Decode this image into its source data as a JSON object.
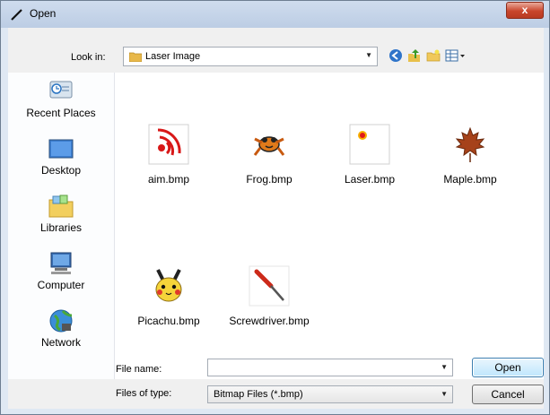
{
  "window": {
    "title": "Open",
    "close_glyph": "x"
  },
  "lookin": {
    "label": "Look in:",
    "value": "Laser Image",
    "arrow": "▼"
  },
  "toolbar": {
    "icons": [
      "back-icon",
      "up-folder-icon",
      "new-folder-icon",
      "view-menu-icon"
    ]
  },
  "places": [
    {
      "label": "Recent Places",
      "icon": "recent-places-icon"
    },
    {
      "label": "Desktop",
      "icon": "desktop-icon"
    },
    {
      "label": "Libraries",
      "icon": "libraries-icon"
    },
    {
      "label": "Computer",
      "icon": "computer-icon"
    },
    {
      "label": "Network",
      "icon": "network-icon"
    }
  ],
  "files": [
    {
      "name": "aim.bmp",
      "icon": "aim-icon"
    },
    {
      "name": "Frog.bmp",
      "icon": "frog-icon"
    },
    {
      "name": "Laser.bmp",
      "icon": "laser-icon"
    },
    {
      "name": "Maple.bmp",
      "icon": "maple-leaf-icon"
    },
    {
      "name": "Picachu.bmp",
      "icon": "pikachu-icon"
    },
    {
      "name": "Screwdriver.bmp",
      "icon": "screwdriver-icon"
    }
  ],
  "filename": {
    "label": "File name:",
    "value": "",
    "arrow": "▼"
  },
  "filetype": {
    "label": "Files of type:",
    "value": "Bitmap Files (*.bmp)",
    "arrow": "▼"
  },
  "buttons": {
    "open": "Open",
    "cancel": "Cancel"
  },
  "colors": {
    "accent": "#3c7fb1",
    "close": "#c9462c"
  }
}
